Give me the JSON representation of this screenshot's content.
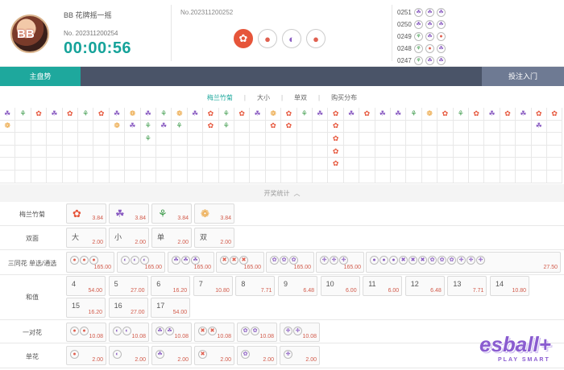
{
  "header": {
    "game_name": "BB 花牌摇一摇",
    "round_label": "No. 202311200254",
    "timer": "00:00:56",
    "last_round_label": "No.202311200252",
    "avatar_text": "BB",
    "result": [
      "plum",
      "orchid-petal",
      "orchid-half",
      "plum-petal"
    ]
  },
  "history": [
    {
      "no": "0251",
      "icons": [
        "orchid",
        "orchid",
        "orchid"
      ]
    },
    {
      "no": "0250",
      "icons": [
        "orchid",
        "orchid",
        "orchid"
      ]
    },
    {
      "no": "0249",
      "icons": [
        "bamboo",
        "orchid",
        "petal"
      ]
    },
    {
      "no": "0248",
      "icons": [
        "bamboo",
        "petal",
        "orchid"
      ]
    },
    {
      "no": "0247",
      "icons": [
        "bamboo",
        "orchid",
        "orchid"
      ]
    }
  ],
  "tabs": {
    "main": "主盘势",
    "bet": "投注入门"
  },
  "subtabs": [
    "梅兰竹菊",
    "大小",
    "单双",
    "购买分布"
  ],
  "stats_label": "开奖统计",
  "rows": {
    "flowers": {
      "label": "梅兰竹菊",
      "items": [
        {
          "odds": "3.84"
        },
        {
          "odds": "3.84"
        },
        {
          "odds": "3.84"
        },
        {
          "odds": "3.84"
        }
      ]
    },
    "bigsmall": {
      "label": "双面",
      "items": [
        {
          "name": "大",
          "odds": "2.00"
        },
        {
          "name": "小",
          "odds": "2.00"
        },
        {
          "name": "单",
          "odds": "2.00"
        },
        {
          "name": "双",
          "odds": "2.00"
        }
      ]
    },
    "triple": {
      "label": "三同花 单选/通选",
      "odds": [
        "165.00",
        "165.00",
        "165.00",
        "165.00",
        "165.00",
        "165.00",
        "27.50"
      ]
    },
    "sum": {
      "label": "和值",
      "items": [
        {
          "n": "4",
          "odds": "54.00"
        },
        {
          "n": "5",
          "odds": "27.00"
        },
        {
          "n": "6",
          "odds": "16.20"
        },
        {
          "n": "7",
          "odds": "10.80"
        },
        {
          "n": "8",
          "odds": "7.71"
        },
        {
          "n": "9",
          "odds": "6.48"
        },
        {
          "n": "10",
          "odds": "6.00"
        },
        {
          "n": "11",
          "odds": "6.00"
        },
        {
          "n": "12",
          "odds": "6.48"
        },
        {
          "n": "13",
          "odds": "7.71"
        },
        {
          "n": "14",
          "odds": "10.80"
        },
        {
          "n": "15",
          "odds": "16.20"
        },
        {
          "n": "16",
          "odds": "27.00"
        },
        {
          "n": "17",
          "odds": "54.00"
        }
      ]
    },
    "pair": {
      "label": "一对花",
      "odds": [
        "10.08",
        "10.08",
        "10.08",
        "10.08",
        "10.08",
        "10.08"
      ]
    },
    "single": {
      "label": "单花",
      "odds": [
        "2.00",
        "2.00",
        "2.00",
        "2.00",
        "2.00",
        "2.00"
      ]
    }
  },
  "logo": {
    "main": "esball+",
    "sub": "PLAY SMART"
  }
}
